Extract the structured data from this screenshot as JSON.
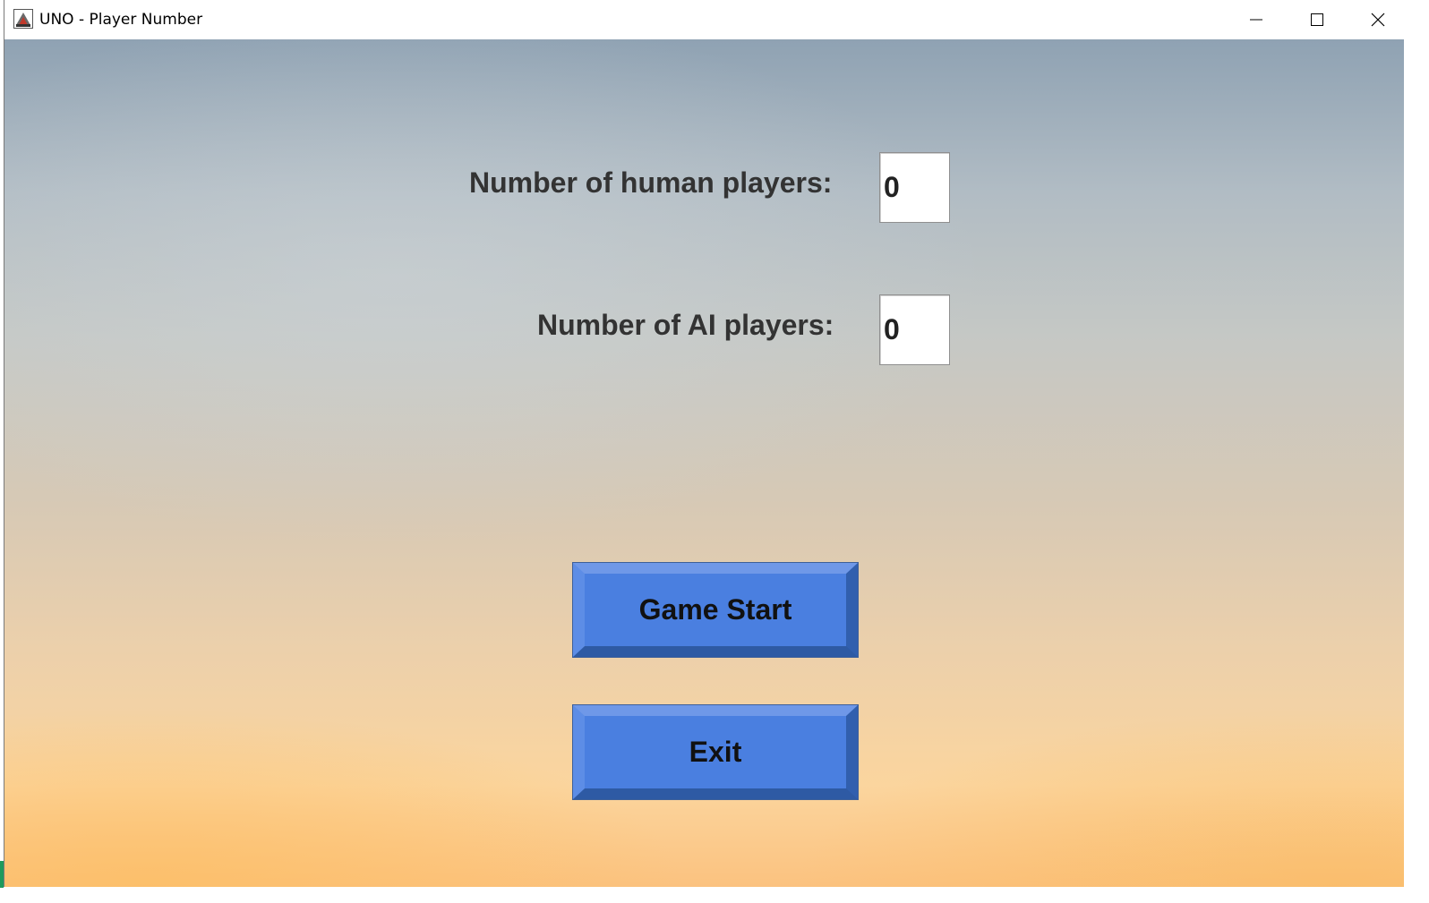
{
  "window": {
    "title": "UNO - Player Number"
  },
  "titlebar_buttons": {
    "minimize_icon": "minimize-icon",
    "maximize_icon": "maximize-icon",
    "close_icon": "close-icon"
  },
  "form": {
    "human_label": "Number of human players:",
    "human_value": "0",
    "ai_label": "Number of AI players:",
    "ai_value": "0"
  },
  "buttons": {
    "start_label": "Game Start",
    "exit_label": "Exit"
  },
  "colors": {
    "button_face": "#4a7fe0",
    "label_text": "#333333",
    "sky_top": "#8fa2b3",
    "sky_bottom": "#fbc27f"
  }
}
